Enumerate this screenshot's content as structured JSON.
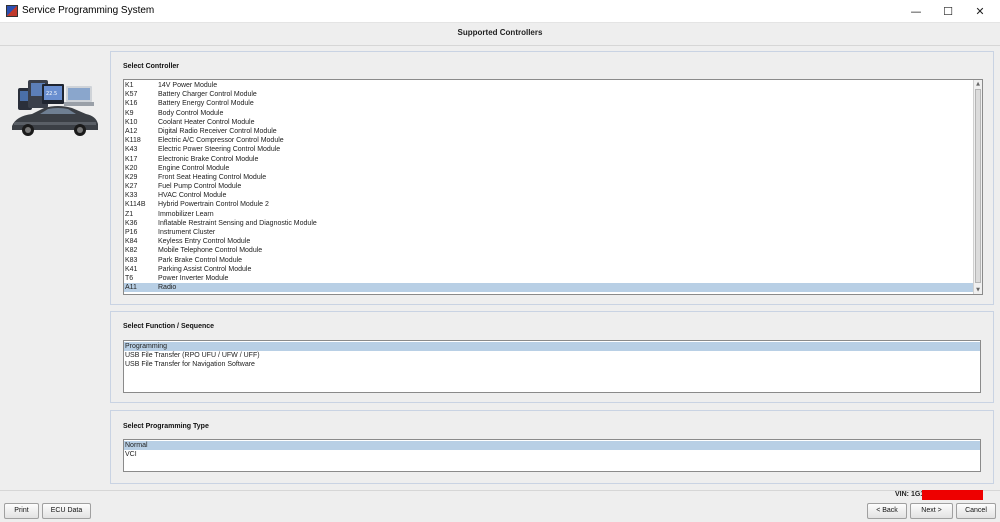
{
  "window": {
    "title": "Service Programming System",
    "min_glyph": "—",
    "max_glyph": "☐",
    "close_glyph": "✕"
  },
  "header": {
    "title": "Supported Controllers"
  },
  "controller_panel": {
    "title": "Select Controller",
    "items": [
      {
        "code": "K1",
        "name": "14V Power Module"
      },
      {
        "code": "K57",
        "name": "Battery Charger Control Module"
      },
      {
        "code": "K16",
        "name": "Battery Energy Control Module"
      },
      {
        "code": "K9",
        "name": "Body Control Module"
      },
      {
        "code": "K10",
        "name": "Coolant Heater Control Module"
      },
      {
        "code": "A12",
        "name": "Digital Radio Receiver Control Module"
      },
      {
        "code": "K118",
        "name": "Electric A/C Compressor Control Module"
      },
      {
        "code": "K43",
        "name": "Electric Power Steering Control Module"
      },
      {
        "code": "K17",
        "name": "Electronic Brake Control Module"
      },
      {
        "code": "K20",
        "name": "Engine Control Module"
      },
      {
        "code": "K29",
        "name": "Front Seat Heating Control Module"
      },
      {
        "code": "K27",
        "name": "Fuel Pump Control Module"
      },
      {
        "code": "K33",
        "name": "HVAC Control Module"
      },
      {
        "code": "K114B",
        "name": "Hybrid Powertrain Control Module 2"
      },
      {
        "code": "Z1",
        "name": "Immobilizer Learn"
      },
      {
        "code": "K36",
        "name": "Inflatable Restraint Sensing and Diagnostic Module"
      },
      {
        "code": "P16",
        "name": "Instrument Cluster"
      },
      {
        "code": "K84",
        "name": "Keyless Entry Control Module"
      },
      {
        "code": "K82",
        "name": "Mobile Telephone Control Module"
      },
      {
        "code": "K83",
        "name": "Park Brake Control Module"
      },
      {
        "code": "K41",
        "name": "Parking Assist Control Module"
      },
      {
        "code": "T6",
        "name": "Power Inverter Module"
      },
      {
        "code": "A11",
        "name": "Radio"
      }
    ],
    "selected_index": 22
  },
  "function_panel": {
    "title": "Select Function / Sequence",
    "items": [
      "Programming",
      "USB File Transfer (RPO UFU / UFW / UFF)",
      "USB File Transfer for Navigation Software"
    ],
    "selected_index": 0
  },
  "programming_type_panel": {
    "title": "Select Programming Type",
    "items": [
      "Normal",
      "VCI"
    ],
    "selected_index": 0
  },
  "footer": {
    "vin_label": "VIN: 1G1",
    "vin_redaction_color": "#ee0000",
    "buttons": {
      "print": "Print",
      "ecu_data": "ECU Data",
      "back": "< Back",
      "next": "Next >",
      "cancel": "Cancel"
    }
  },
  "graphic": {
    "device_screen_text": "22.5"
  },
  "colors": {
    "selection": "#b8cfe5",
    "panel_border": "#c9d3e3",
    "background": "#eeeeee"
  }
}
